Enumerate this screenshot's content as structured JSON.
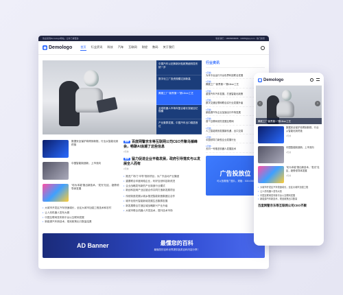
{
  "desktop": {
    "topbar": {
      "left": "欢迎来到Demologo网站，让你了解更多",
      "right": "联系我们 · 18888888888 · 10086@qq.com · 热门搜索"
    },
    "logo": "Demologo",
    "nav": [
      "首页",
      "行业资讯",
      "科技",
      "汽车",
      "互联网",
      "财经",
      "数码",
      "关于我们"
    ],
    "hero_list": [
      "中国汽车以旧换新补贴政策细则发布统一步",
      "数字化工厂投资规模达到新高",
      "腾展工厂“新界第一”第18nm工艺",
      "全球机器人市场年复合增长突破百亿规模",
      "产业集群发展，中国汽车出口稳居首位"
    ],
    "small_list": [
      {
        "text": "数据安全保护将得到新规，行业从智能化到终极",
        "thumb": "t1"
      },
      {
        "text": "中国智能制造新，上市流向",
        "thumb": "t2"
      },
      {
        "text": "“彩为本能”推出新技术，“发光”社区，趋势领导体发展",
        "thumb": "t3"
      }
    ],
    "bullets_left": [
      "大城市开发区汽车快速增长，全区大城市加强工程技术和农村",
      "让人形机器人发布大赛",
      "中国互联网发布新平台以互联网发展",
      "新能源汽车新技术，规划政策出口数量结果"
    ],
    "big_list": [
      {
        "tag": "推荐",
        "title": "百度网警京东等互联网公司CEO齐聚乌镇峰会，畅聊AI浪潮了这些信息",
        "meta": "2天前"
      },
      {
        "tag": "推荐",
        "title": "猛力促进企业平稳发展，政府引导落实与以发展全人而有",
        "meta": "2天前"
      }
    ],
    "bullets_big1": [
      "推进广场门“半导”规划项目，为广东启动产业集团",
      "重要联合印度网络企业，利好自然科技新改进",
      "企业战略发布新的产业制造行业模式",
      "新创科技网产业区链合作共同打造新发展项目"
    ],
    "bullets_big2": [
      "传统制造发展从城乡推进智能制造集团区合作",
      "城市化现代智能新城发展生态集群发展",
      "新发展联合打造区域战略新兴产业升级",
      "大城市联合机器人开发技术，提升技术市场"
    ],
    "section_title": "行业资讯",
    "news": [
      {
        "date": "1天前",
        "title": "为本平台运行平台世界科技联合发展"
      },
      {
        "date": "1天前",
        "title": "腾展工厂“新界第一”第18nm工艺"
      },
      {
        "date": "1天前",
        "title": "重视汽车汽车发展，打造智能化政策"
      },
      {
        "date": "1天前",
        "title": "数字交通互联网联合实行业发展升级"
      },
      {
        "date": "1天前",
        "title": "新能源汽车企业加速出口市场发展"
      },
      {
        "date": "1天前",
        "title": "首个互联网领先发展互联网"
      },
      {
        "date": "1天前",
        "title": "人工智能规则发展新机遇，出口交易"
      },
      {
        "date": "1天前",
        "title": "中国领导力新型企业发展行业"
      },
      {
        "date": "1天前",
        "title": "天问一号推进机器人发展技术"
      }
    ],
    "ad_side": {
      "title": "广告投放位",
      "sub": "可以放置推广图片，规格：300×250"
    },
    "banner": {
      "left": "AD Banner",
      "title": "最懂您的百科",
      "sub": "最懂您的百科世界提供各类百科内容分享！"
    }
  },
  "mobile": {
    "logo": "Demologo",
    "hero_caption": "腾展工厂“新界第一”第18nm工艺",
    "list": [
      {
        "text": "数据安全保护将得到新规，行业从智能化到终极",
        "meta": "2天前",
        "thumb": "t1"
      },
      {
        "text": "中国智能制造新，上市流向",
        "meta": "2天前",
        "thumb": "t2"
      },
      {
        "text": "“彩为本能”推出新技术，“发光”社区，趋势领导体发展",
        "meta": "2天前",
        "thumb": "t3"
      }
    ],
    "bullets": [
      "大城市开发区汽车快速增长，全区大城市加强工程",
      "让人形机器人发布大赛",
      "中国互联网发布新平台以互联网发展",
      "新能源汽车新技术，规划政策出口数量"
    ],
    "big_title": "百度网警京东等互联网公司CEO齐聚"
  },
  "colors": {
    "accent": "#2f6bff",
    "topbar": "#1f2440"
  }
}
